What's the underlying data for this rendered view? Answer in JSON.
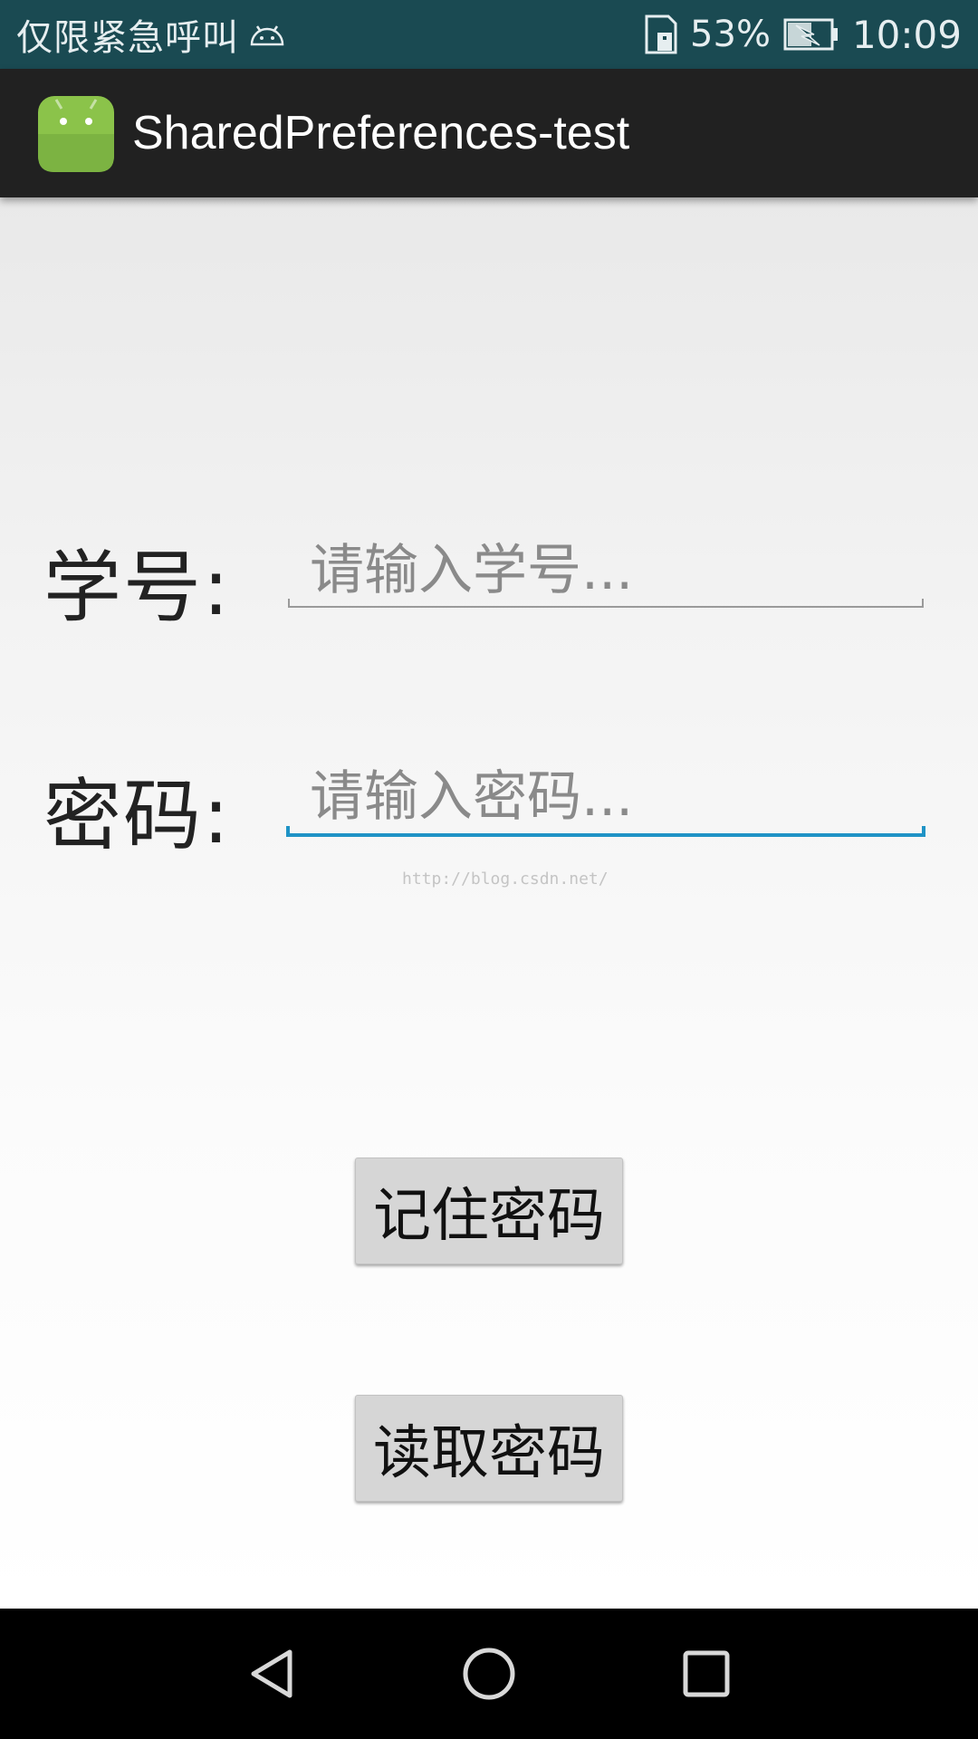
{
  "status_bar": {
    "carrier": "仅限紧急呼叫",
    "battery_percent": "53%",
    "time": "10:09",
    "icons": [
      "android-notification-icon",
      "sim-card-icon",
      "battery-charging-icon"
    ]
  },
  "action_bar": {
    "title": "SharedPreferences-test",
    "icon": "android-app-icon"
  },
  "form": {
    "student_id_label": "学号:",
    "student_id_placeholder": "请输入学号...",
    "password_label": "密码:",
    "password_placeholder": "请输入密码..."
  },
  "watermark": "http://blog.csdn.net/",
  "buttons": {
    "remember": "记住密码",
    "read": "读取密码"
  },
  "nav_bar": {
    "icons": [
      "back-icon",
      "home-icon",
      "recents-icon"
    ]
  },
  "colors": {
    "status_bar": "#1a4a52",
    "action_bar": "#212121",
    "focus_accent": "#1f93c6",
    "button": "#d6d6d6"
  }
}
